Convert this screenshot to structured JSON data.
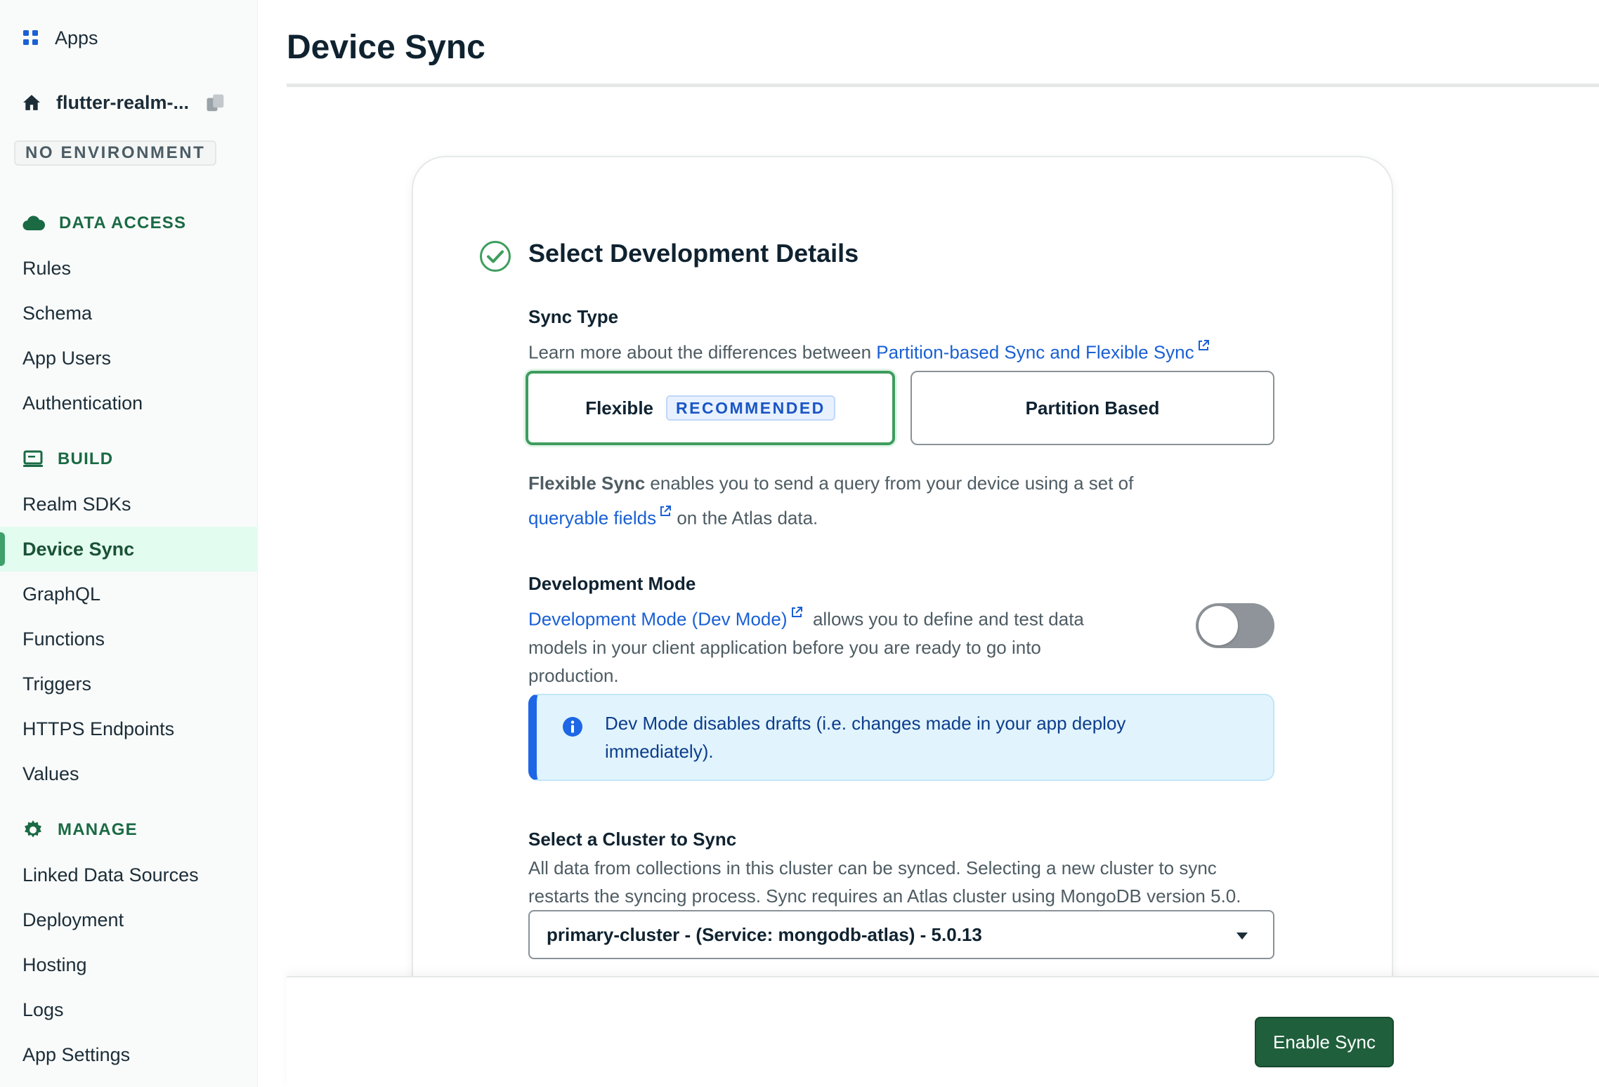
{
  "sidebar": {
    "apps_label": "Apps",
    "app_name": "flutter-realm-...",
    "environment_badge": "NO ENVIRONMENT",
    "sections": [
      {
        "title": "DATA ACCESS",
        "icon": "cloud-icon",
        "items": [
          "Rules",
          "Schema",
          "App Users",
          "Authentication"
        ]
      },
      {
        "title": "BUILD",
        "icon": "build-laptop-icon",
        "items": [
          "Realm SDKs",
          "Device Sync",
          "GraphQL",
          "Functions",
          "Triggers",
          "HTTPS Endpoints",
          "Values"
        ]
      },
      {
        "title": "MANAGE",
        "icon": "gear-icon",
        "items": [
          "Linked Data Sources",
          "Deployment",
          "Hosting",
          "Logs",
          "App Settings"
        ]
      }
    ],
    "active_item": "Device Sync"
  },
  "page": {
    "title": "Device Sync"
  },
  "step": {
    "title": "Select Development Details",
    "status_icon": "check-circle-icon"
  },
  "sync_type": {
    "label": "Sync Type",
    "description_prefix": "Learn more about the differences between ",
    "description_link": "Partition-based Sync and Flexible Sync",
    "options": [
      {
        "label": "Flexible",
        "badge": "RECOMMENDED",
        "selected": true
      },
      {
        "label": "Partition Based",
        "selected": false
      }
    ],
    "explain_bold": "Flexible Sync",
    "explain_mid": " enables you to send a query from your device using a set of",
    "explain_link": "queryable fields",
    "explain_tail": " on the Atlas data."
  },
  "dev_mode": {
    "label": "Development Mode",
    "link": "Development Mode (Dev Mode)",
    "line1_tail": "  allows you to define and test data",
    "line2": "models in your client application before you are ready to go into",
    "line3": "production.",
    "enabled": false,
    "callout": "Dev Mode disables drafts (i.e. changes made in your app deploy immediately)."
  },
  "cluster": {
    "label": "Select a Cluster to Sync",
    "description_line1": "All data from collections in this cluster can be synced. Selecting a new cluster to sync",
    "description_line2": "restarts the syncing process. Sync requires an Atlas cluster using MongoDB version 5.0.",
    "selected": "primary-cluster - (Service: mongodb-atlas) - 5.0.13"
  },
  "footer": {
    "enable_button": "Enable Sync"
  },
  "colors": {
    "accent_green": "#1f5f3c",
    "selected_border": "#3e9d5d",
    "link_blue": "#1a60d4",
    "callout_bg": "#e1f4fd"
  }
}
